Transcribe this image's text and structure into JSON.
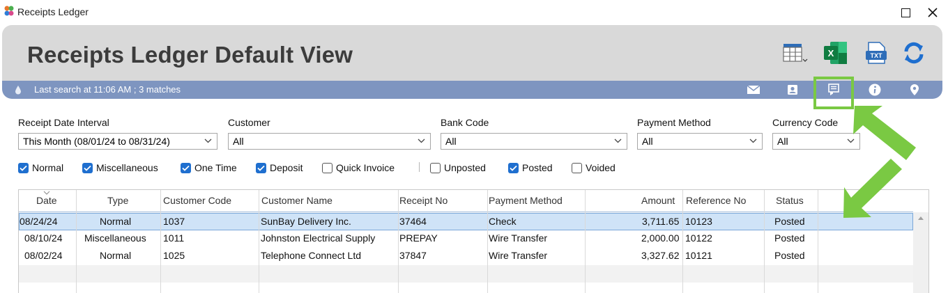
{
  "window": {
    "title": "Receipts Ledger"
  },
  "header": {
    "title": "Receipts Ledger Default View"
  },
  "status": {
    "text": "Last search at 11:06 AM ; 3 matches"
  },
  "toolbar_icons": [
    "columns-icon",
    "excel-icon",
    "txt-icon",
    "refresh-icon"
  ],
  "action_icons": [
    "email-icon",
    "contact-icon",
    "receipt-icon",
    "info-icon",
    "location-icon"
  ],
  "filters": {
    "receipt_date_interval": {
      "label": "Receipt Date Interval",
      "value": "This Month (08/01/24 to 08/31/24)"
    },
    "customer": {
      "label": "Customer",
      "value": "All"
    },
    "bank_code": {
      "label": "Bank Code",
      "value": "All"
    },
    "payment_method": {
      "label": "Payment Method",
      "value": "All"
    },
    "currency_code": {
      "label": "Currency Code",
      "value": "All"
    }
  },
  "checkboxes": [
    {
      "label": "Normal",
      "checked": true
    },
    {
      "label": "Miscellaneous",
      "checked": true
    },
    {
      "label": "One Time",
      "checked": true
    },
    {
      "label": "Deposit",
      "checked": true
    },
    {
      "label": "Quick Invoice",
      "checked": false
    },
    {
      "label": "Unposted",
      "checked": false
    },
    {
      "label": "Posted",
      "checked": true
    },
    {
      "label": "Voided",
      "checked": false
    }
  ],
  "table": {
    "columns": [
      "Date",
      "Type",
      "Customer Code",
      "Customer Name",
      "Receipt No",
      "Payment Method",
      "Amount",
      "Reference No",
      "Status"
    ],
    "rows": [
      [
        "08/24/24",
        "Normal",
        "1037",
        "SunBay Delivery Inc.",
        "37464",
        "Check",
        "3,711.65",
        "10123",
        "Posted"
      ],
      [
        "08/10/24",
        "Miscellaneous",
        "1011",
        "Johnston Electrical Supply",
        "PREPAY",
        "Wire Transfer",
        "2,000.00",
        "10122",
        "Posted"
      ],
      [
        "08/02/24",
        "Normal",
        "1025",
        "Telephone Connect Ltd",
        "37847",
        "Wire Transfer",
        "3,327.62",
        "10121",
        "Posted"
      ]
    ]
  },
  "colors": {
    "header_bg": "#d9d9d9",
    "status_bg": "#7e95c0",
    "highlight": "#7ac943",
    "checkbox": "#1f6fcf",
    "selected_row": "#cfe3f7"
  }
}
